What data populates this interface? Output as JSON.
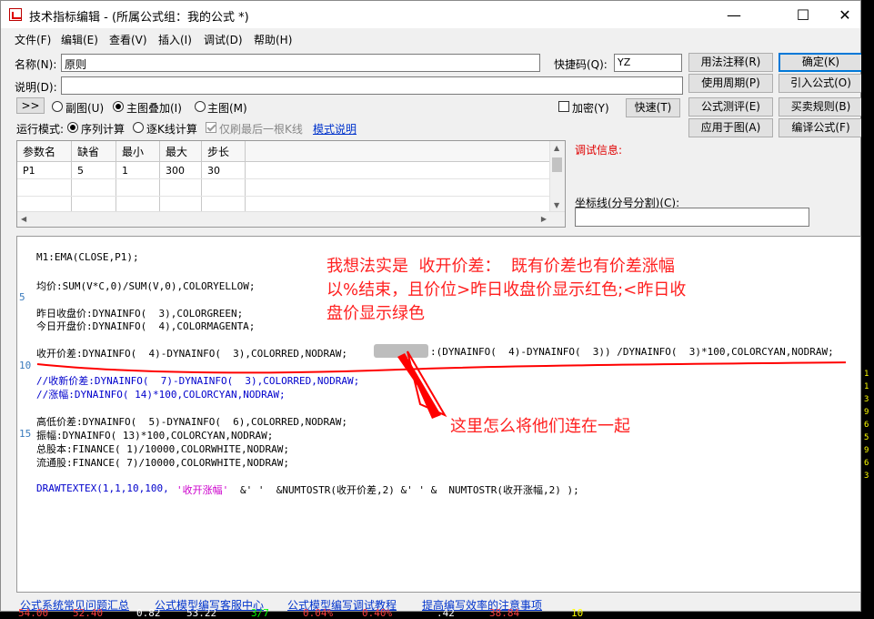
{
  "window": {
    "title": "技术指标编辑 - (所属公式组：我的公式 *)",
    "minimize": "—",
    "maximize": "☐",
    "close": "✕"
  },
  "menu": [
    "文件(F)",
    "编辑(E)",
    "查看(V)",
    "插入(I)",
    "调试(D)",
    "帮助(H)"
  ],
  "form": {
    "name_label": "名称(N):",
    "name_value": "原则",
    "shortcut_label": "快捷码(Q):",
    "shortcut_value": "YZ",
    "desc_label": "说明(D):",
    "desc_value": "",
    "expand_button": ">>",
    "radio_sub": "副图(U)",
    "radio_main_overlay": "主图叠加(I)",
    "radio_main": "主图(M)",
    "encrypt_label": "加密(Y)",
    "run_mode_label": "运行模式:",
    "radio_seq": "序列计算",
    "radio_bar": "逐K线计算",
    "last_bar_only": "仅刷最后一根K线",
    "mode_help_link": "模式说明",
    "debug_info_label": "调试信息:",
    "axis_label": "坐标线(分号分割)(C):",
    "axis_value": ""
  },
  "buttons": {
    "syntax_note": "用法注释(R)",
    "ok": "确定(K)",
    "use_period": "使用周期(P)",
    "import_formula": "引入公式(O)",
    "speed": "快速(T)",
    "formula_test": "公式测评(E)",
    "trade_rules": "买卖规则(B)",
    "apply_chart": "应用于图(A)",
    "compile": "编译公式(F)"
  },
  "params": {
    "headers": [
      "参数名",
      "缺省",
      "最小",
      "最大",
      "步长"
    ],
    "rows": [
      [
        "P1",
        "5",
        "1",
        "300",
        "30"
      ]
    ]
  },
  "editor": {
    "line_numbers": [
      "5",
      "10",
      "15"
    ],
    "lines": {
      "l1": "M1:EMA(CLOSE,P1);",
      "l2": "均价:SUM(V*C,0)/SUM(V,0),COLORYELLOW;",
      "l3": "昨日收盘价:DYNAINFO(  3),COLORGREEN;",
      "l4": "今日开盘价:DYNAINFO(  4),COLORMAGENTA;",
      "l5a": "收开价差:DYNAINFO(  4)-DYNAINFO(  3),COLORRED,NODRAW;",
      "l5b": ":(DYNAINFO(  4)-DYNAINFO(  3)) /DYNAINFO(  3)*100,COLORCYAN,NODRAW;",
      "l6": "//收新价差:DYNAINFO(  7)-DYNAINFO(  3),COLORRED,NODRAW;",
      "l7": "//涨幅:DYNAINFO( 14)*100,COLORCYAN,NODRAW;",
      "l8": "高低价差:DYNAINFO(  5)-DYNAINFO(  6),COLORRED,NODRAW;",
      "l9": "振幅:DYNAINFO( 13)*100,COLORCYAN,NODRAW;",
      "l10": "总股本:FINANCE( 1)/10000,COLORWHITE,NODRAW;",
      "l11": "流通股:FINANCE( 7)/10000,COLORWHITE,NODRAW;",
      "l12a": "DRAWTEXTEX(1,1,10,100,",
      "l12b": "'收开涨幅'",
      "l12c": "&' '  &NUMTOSTR(收开价差,2) &' ' &  NUMTOSTR(收开涨幅,2) );"
    },
    "annotation_top": "我想法实是  收开价差：  既有价差也有价差涨幅\n以%结束，且价位>昨日收盘价显示红色;<昨日收\n盘价显示绿色",
    "annotation_bottom": "这里怎么将他们连在一起"
  },
  "footer_links": [
    "公式系统常见问题汇总",
    "公式模型编写客服中心",
    "公式模型编写调试教程",
    "提高编写效率的注意事项"
  ],
  "ticker": [
    "54.00",
    "52.40",
    "0.82",
    "53.22",
    "3/7",
    "0.04%",
    "0.40%",
    ".42",
    "38.84",
    "10"
  ],
  "right_strip": [
    "1",
    "1",
    "3",
    "9",
    "6",
    "5",
    "9",
    "6",
    "3"
  ],
  "colors": {
    "accent": "#0078d7",
    "annotation": "#ff2020",
    "keyword": "#0000cc",
    "string": "#cc00cc"
  }
}
